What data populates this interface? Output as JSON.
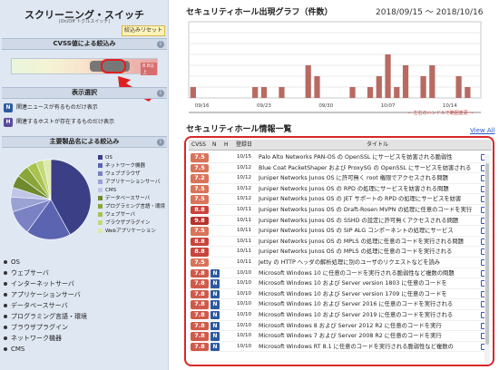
{
  "sidebar": {
    "title": "スクリーニング・スイッチ",
    "subtitle": "(On/Off トグルスイッチ)",
    "reset_label": "絞込みリセット",
    "cvss_section": "CVSS値による絞込み",
    "cvss_selected_label": "8.8以上",
    "display_section": "表示選択",
    "options": [
      {
        "badge": "N",
        "label": "関連ニュースが有るものだけ表示",
        "color": "#2c5aa0"
      },
      {
        "badge": "H",
        "label": "関連するホストが存在するものだけ表示",
        "color": "#5a4b9a"
      }
    ],
    "product_section": "主要製品名による絞込み",
    "legend": [
      {
        "label": "OS",
        "color": "#3b3f86"
      },
      {
        "label": "ネットワーク機器",
        "color": "#5b64b0"
      },
      {
        "label": "ウェブブラウザ",
        "color": "#7b82c4"
      },
      {
        "label": "アプリケーションサーバ",
        "color": "#9aa2d4"
      },
      {
        "label": "CMS",
        "color": "#c1c6e6"
      },
      {
        "label": "データベースサーバ",
        "color": "#6e8a2c"
      },
      {
        "label": "プログラミング言語・環境",
        "color": "#8aa63a"
      },
      {
        "label": "ウェブサーバ",
        "color": "#a9c24f"
      },
      {
        "label": "ブラウザプラグイン",
        "color": "#c3d87a"
      },
      {
        "label": "Webアプリケーション",
        "color": "#dce9a9"
      }
    ],
    "products": [
      "OS",
      "ウェブサーバ",
      "インターネットサーバ",
      "アプリケーションサーバ",
      "データベースサーバ",
      "プログラミング言語・環境",
      "ブラウザプラグイン",
      "ネットワーク機器",
      "CMS"
    ]
  },
  "graph": {
    "title": "セキュリティホール出現グラフ（件数）",
    "date_range": "2018/09/15 ～ 2018/10/16",
    "drag_hint": "← 左右のハンドルで範囲変更 →"
  },
  "chart_data": {
    "type": "bar",
    "title": "セキュリティホール出現グラフ（件数）",
    "x_tick_labels": [
      "09/16",
      "09/23",
      "09/30",
      "10/07",
      "10/14"
    ],
    "values": [
      1,
      0,
      0,
      0,
      0,
      0,
      0,
      1,
      1,
      0,
      1,
      0,
      0,
      3,
      2,
      0,
      0,
      0,
      1,
      0,
      1,
      2,
      4,
      1,
      3,
      0,
      2,
      3,
      0,
      0,
      2,
      1,
      0
    ],
    "ylim": [
      0,
      7
    ],
    "grid": true,
    "bar_color": "#b86a62"
  },
  "list": {
    "title": "セキュリティホール情報一覧",
    "view_all": "View All",
    "columns": {
      "cvss": "CVSS",
      "n": "N",
      "h": "H",
      "date": "登録日",
      "title": "タイトル"
    },
    "rows": [
      {
        "cvss": "7.5",
        "color": "#d9735a",
        "n": false,
        "date": "10/15",
        "title": "Palo Alto Networks PAN-OS の OpenSSL にサービスを妨害される脆弱性"
      },
      {
        "cvss": "7.5",
        "color": "#d9735a",
        "n": false,
        "date": "10/12",
        "title": "Blue Coat PacketShaper および ProxySG の OpenSSL にサービスを妨害される"
      },
      {
        "cvss": "7.2",
        "color": "#d9735a",
        "n": false,
        "date": "10/12",
        "title": "Juniper Networks Junos OS に許可無く root 権限でアクセスされる問題"
      },
      {
        "cvss": "7.5",
        "color": "#d9735a",
        "n": false,
        "date": "10/12",
        "title": "Juniper Networks Junos OS の RPD の処理にサービスを妨害される問題"
      },
      {
        "cvss": "7.5",
        "color": "#d9735a",
        "n": false,
        "date": "10/12",
        "title": "Juniper Networks Junos OS の JET サポートの RPD の処理にサービスを妨害"
      },
      {
        "cvss": "8.8",
        "color": "#c9433c",
        "n": false,
        "date": "10/11",
        "title": "Juniper Networks Junos OS の Draft-Rosen MVPN の処理に任意のコードを実行"
      },
      {
        "cvss": "9.8",
        "color": "#b8322d",
        "n": false,
        "date": "10/11",
        "title": "Juniper Networks Junos OS の SSHD の設定に許可無くアクセスされる問題"
      },
      {
        "cvss": "7.5",
        "color": "#d9735a",
        "n": false,
        "date": "10/11",
        "title": "Juniper Networks Junos OS の SIP ALG コンポーネントの処理にサービス"
      },
      {
        "cvss": "8.8",
        "color": "#c9433c",
        "n": false,
        "date": "10/11",
        "title": "Juniper Networks Junos OS の MPLS の処理に任意のコードを実行される問題"
      },
      {
        "cvss": "8.8",
        "color": "#c9433c",
        "n": false,
        "date": "10/11",
        "title": "Juniper Networks Junos OS の MPLS の処理に任意のコードを実行される"
      },
      {
        "cvss": "7.5",
        "color": "#d9735a",
        "n": false,
        "date": "10/11",
        "title": "Jetty の HTTP ヘッダの解析処理に別のユーザのリクエストなどを読み"
      },
      {
        "cvss": "7.8",
        "color": "#d05a4a",
        "n": true,
        "date": "10/10",
        "title": "Microsoft Windows 10 に任意のコードを実行される脆弱性など複数の問題"
      },
      {
        "cvss": "7.8",
        "color": "#d05a4a",
        "n": true,
        "date": "10/10",
        "title": "Microsoft Windows 10 および Server version 1803 に任意のコードを"
      },
      {
        "cvss": "7.8",
        "color": "#d05a4a",
        "n": true,
        "date": "10/10",
        "title": "Microsoft Windows 10 および Server version 1709 に任意のコードを"
      },
      {
        "cvss": "7.8",
        "color": "#d05a4a",
        "n": true,
        "date": "10/10",
        "title": "Microsoft Windows 10 および Server 2016 に任意のコードを実行される"
      },
      {
        "cvss": "7.8",
        "color": "#d05a4a",
        "n": true,
        "date": "10/10",
        "title": "Microsoft Windows 10 および Server 2019 に任意のコードを実行される"
      },
      {
        "cvss": "7.8",
        "color": "#d05a4a",
        "n": true,
        "date": "10/10",
        "title": "Microsoft Windows 8 および Server 2012 R2 に任意のコードを実行"
      },
      {
        "cvss": "7.8",
        "color": "#d05a4a",
        "n": true,
        "date": "10/10",
        "title": "Microsoft Windows 7 および Server 2008 R2 に任意のコードを実行"
      },
      {
        "cvss": "7.8",
        "color": "#d05a4a",
        "n": true,
        "date": "10/10",
        "title": "Microsoft Windows RT 8.1 に任意のコードを実行される脆弱性など複数の"
      }
    ]
  }
}
